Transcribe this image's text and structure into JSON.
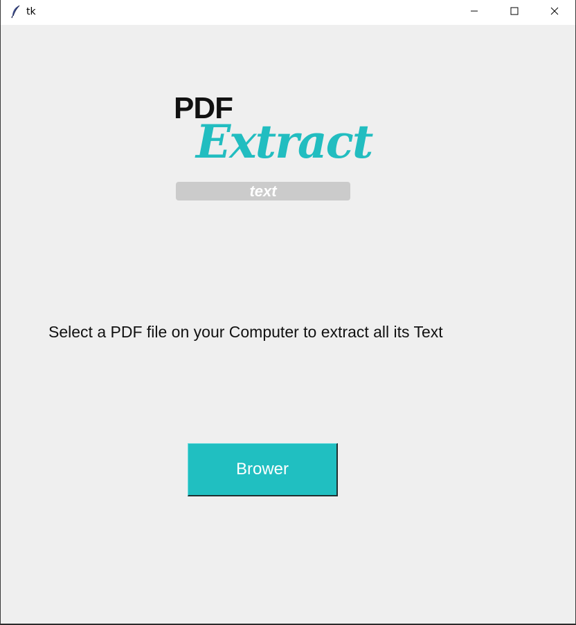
{
  "window": {
    "title": "tk",
    "icons": {
      "app": "feather-icon",
      "minimize": "minimize-icon",
      "maximize": "maximize-icon",
      "close": "close-icon"
    }
  },
  "logo": {
    "line1": "PDF",
    "line2": "Extract",
    "tag": "text",
    "colors": {
      "pdf": "#111111",
      "extract": "#22bdc0",
      "tag_bar": "#cbcbcb",
      "tag_text": "#ffffff"
    }
  },
  "main": {
    "instruction": "Select a PDF file on your Computer to extract all its Text",
    "button_label": "Brower"
  },
  "colors": {
    "background": "#efefef",
    "button": "#20bfc1",
    "button_text": "#ffffff"
  }
}
